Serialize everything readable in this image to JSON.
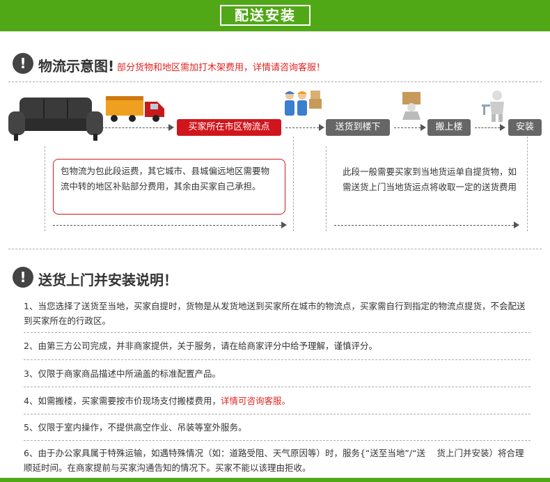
{
  "header": {
    "title": "配送安装"
  },
  "logistics": {
    "title": "物流示意图!",
    "note": "部分货物和地区需加打木架费用，详情请咨询客服！",
    "steps": [
      "买家所在市区物流点",
      "送货到楼下",
      "搬上楼",
      "安装"
    ],
    "left_desc": "包物流为包此段运费，其它城市、县城偏远地区需要物流中转的地区补贴部分费用，其余由买家自己承担。",
    "right_desc": "此段一般需要买家到当地货运单自提货物，如需送货上门当地货运点将收取一定的送货费用"
  },
  "install": {
    "title": "送货上门并安装说明！",
    "rules": [
      {
        "text": "1、当您选择了送货至当地，买家自提时，货物是从发货地送到买家所在城市的物流点，买家需自行到指定的物流点提货，不会配送到买家所在的行政区。"
      },
      {
        "text": "2、由第三方公司完成，并非商家提供，关于服务，请在给商家评分中给予理解，谨慎评分。"
      },
      {
        "text": "3、仅限于商家商品描述中所涵盖的标准配置产品。"
      },
      {
        "text": "4、如需搬楼，买家需要按市价现场支付搬楼费用，",
        "highlight": "详情可咨询客服。"
      },
      {
        "text": "5、仅限于室内操作，不提供高空作业、吊装等室外服务。"
      },
      {
        "text": "6、由于办公家具属于特殊运输，如遇特殊情况（如：道路受阻、天气原因等）时，服务{“送至当地”/“送　 货上门并安装）将合理顺延时间。在商家提前与买家沟通告知的情况下。买家不能以该理由拒收。"
      }
    ]
  },
  "colors": {
    "green": "#51a817",
    "red": "#d0161c",
    "gray": "#666666"
  },
  "icons": [
    "alert-icon",
    "sofa-icon",
    "truck-icon",
    "workers-icon",
    "carry-box-icon",
    "install-worker-icon"
  ]
}
